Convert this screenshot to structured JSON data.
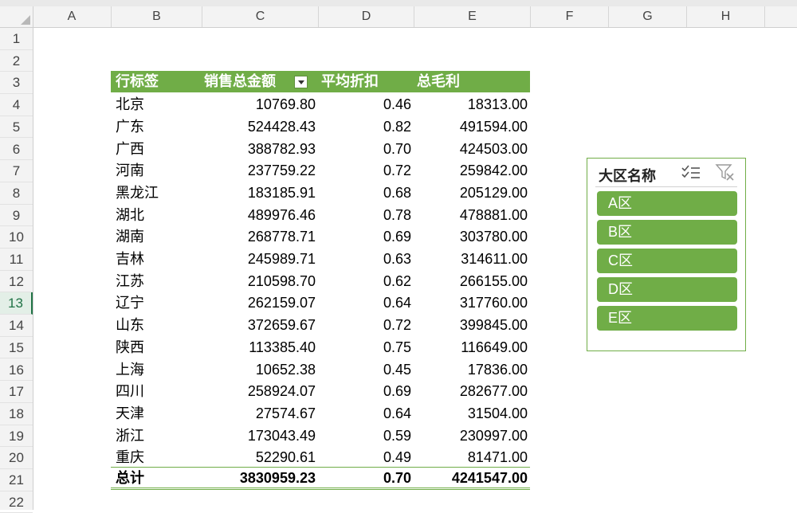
{
  "sheet": {
    "columns": [
      "A",
      "B",
      "C",
      "D",
      "E",
      "F",
      "G",
      "H"
    ],
    "rows": [
      "1",
      "2",
      "3",
      "4",
      "5",
      "6",
      "7",
      "8",
      "9",
      "10",
      "11",
      "12",
      "13",
      "14",
      "15",
      "16",
      "17",
      "18",
      "19",
      "20",
      "21",
      "22"
    ],
    "selected_row": "13"
  },
  "pivot": {
    "headers": {
      "row_label": "行标签",
      "sales": "销售总金额",
      "discount": "平均折扣",
      "profit": "总毛利"
    },
    "rows": [
      {
        "label": "北京",
        "sales": "10769.80",
        "discount": "0.46",
        "profit": "18313.00"
      },
      {
        "label": "广东",
        "sales": "524428.43",
        "discount": "0.82",
        "profit": "491594.00"
      },
      {
        "label": "广西",
        "sales": "388782.93",
        "discount": "0.70",
        "profit": "424503.00"
      },
      {
        "label": "河南",
        "sales": "237759.22",
        "discount": "0.72",
        "profit": "259842.00"
      },
      {
        "label": "黑龙江",
        "sales": "183185.91",
        "discount": "0.68",
        "profit": "205129.00"
      },
      {
        "label": "湖北",
        "sales": "489976.46",
        "discount": "0.78",
        "profit": "478881.00"
      },
      {
        "label": "湖南",
        "sales": "268778.71",
        "discount": "0.69",
        "profit": "303780.00"
      },
      {
        "label": "吉林",
        "sales": "245989.71",
        "discount": "0.63",
        "profit": "314611.00"
      },
      {
        "label": "江苏",
        "sales": "210598.70",
        "discount": "0.62",
        "profit": "266155.00"
      },
      {
        "label": "辽宁",
        "sales": "262159.07",
        "discount": "0.64",
        "profit": "317760.00"
      },
      {
        "label": "山东",
        "sales": "372659.67",
        "discount": "0.72",
        "profit": "399845.00"
      },
      {
        "label": "陕西",
        "sales": "113385.40",
        "discount": "0.75",
        "profit": "116649.00"
      },
      {
        "label": "上海",
        "sales": "10652.38",
        "discount": "0.45",
        "profit": "17836.00"
      },
      {
        "label": "四川",
        "sales": "258924.07",
        "discount": "0.69",
        "profit": "282677.00"
      },
      {
        "label": "天津",
        "sales": "27574.67",
        "discount": "0.64",
        "profit": "31504.00"
      },
      {
        "label": "浙江",
        "sales": "173043.49",
        "discount": "0.59",
        "profit": "230997.00"
      },
      {
        "label": "重庆",
        "sales": "52290.61",
        "discount": "0.49",
        "profit": "81471.00"
      }
    ],
    "total": {
      "label": "总计",
      "sales": "3830959.23",
      "discount": "0.70",
      "profit": "4241547.00"
    }
  },
  "slicer": {
    "title": "大区名称",
    "items": [
      "A区",
      "B区",
      "C区",
      "D区",
      "E区"
    ]
  },
  "colors": {
    "accent": "#70ad47",
    "selected_row_text": "#217346"
  }
}
